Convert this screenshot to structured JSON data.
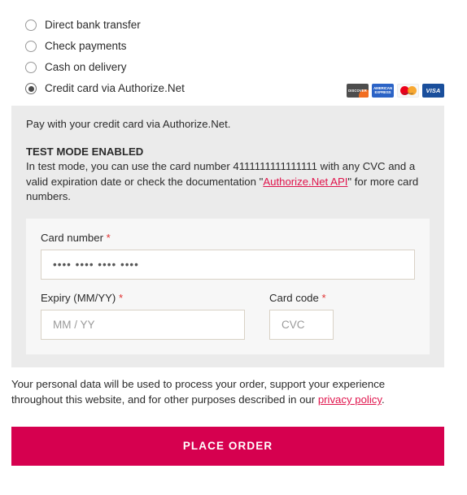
{
  "payment_methods": [
    {
      "id": "bacs",
      "label": "Direct bank transfer",
      "selected": false
    },
    {
      "id": "cheque",
      "label": "Check payments",
      "selected": false
    },
    {
      "id": "cod",
      "label": "Cash on delivery",
      "selected": false
    },
    {
      "id": "authorize_net",
      "label": "Credit card via Authorize.Net",
      "selected": true
    }
  ],
  "card_icons": [
    {
      "name": "discover-card-icon",
      "label": "DISCOVER"
    },
    {
      "name": "amex-card-icon",
      "label_line1": "AMERICAN",
      "label_line2": "EXPRESS"
    },
    {
      "name": "mastercard-card-icon",
      "label": "mastercard"
    },
    {
      "name": "visa-card-icon",
      "label": "VISA"
    }
  ],
  "payment_box": {
    "intro": "Pay with your credit card via Authorize.Net.",
    "test_mode_title": "TEST MODE ENABLED",
    "test_body_part1": "In test mode, you can use the card number 4111111111111111 with any CVC and a valid expiration date or check the documentation \"",
    "test_link_label": "Authorize.Net API",
    "test_body_part2": "\" for more card numbers."
  },
  "card_form": {
    "card_number": {
      "label": "Card number",
      "required_marker": "*",
      "value": "•••• •••• •••• ••••",
      "placeholder": "•••• •••• •••• ••••"
    },
    "expiry": {
      "label": "Expiry (MM/YY)",
      "required_marker": "*",
      "value": "",
      "placeholder": "MM / YY"
    },
    "card_code": {
      "label": "Card code",
      "required_marker": "*",
      "value": "",
      "placeholder": "CVC"
    }
  },
  "privacy": {
    "text_part1": "Your personal data will be used to process your order, support your experience throughout this website, and for other purposes described in our ",
    "link_label": "privacy policy",
    "text_part2": "."
  },
  "place_order": {
    "label": "PLACE ORDER"
  },
  "colors": {
    "accent": "#d6004f",
    "link": "#e0144c",
    "panel": "#ebebeb",
    "card_panel": "#f7f7f7",
    "input_border": "#d9d2c6",
    "required": "#e03131"
  }
}
